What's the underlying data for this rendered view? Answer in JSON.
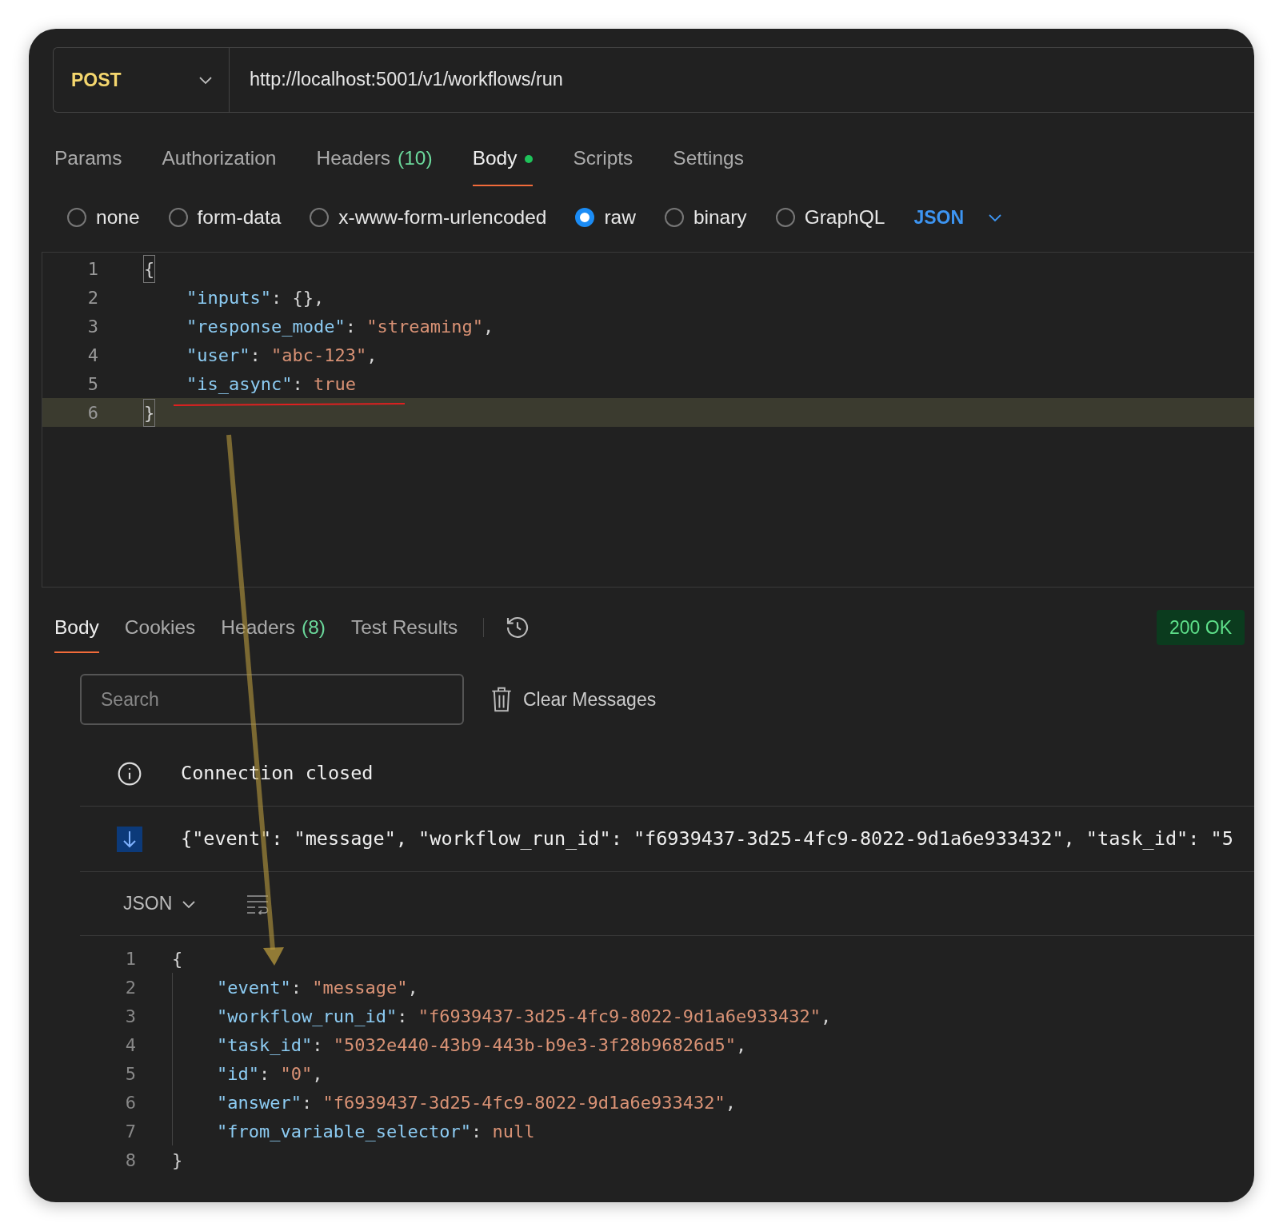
{
  "request": {
    "method": "POST",
    "url": "http://localhost:5001/v1/workflows/run"
  },
  "request_tabs": [
    {
      "label": "Params",
      "selected": false
    },
    {
      "label": "Authorization",
      "selected": false
    },
    {
      "label": "Headers",
      "count": "(10)",
      "selected": false
    },
    {
      "label": "Body",
      "dot": true,
      "selected": true
    },
    {
      "label": "Scripts",
      "selected": false
    },
    {
      "label": "Settings",
      "selected": false
    }
  ],
  "body_types": [
    {
      "label": "none",
      "selected": false
    },
    {
      "label": "form-data",
      "selected": false
    },
    {
      "label": "x-www-form-urlencoded",
      "selected": false
    },
    {
      "label": "raw",
      "selected": true
    },
    {
      "label": "binary",
      "selected": false
    },
    {
      "label": "GraphQL",
      "selected": false
    }
  ],
  "body_language": "JSON",
  "request_body": [
    {
      "number": "1",
      "indented": false,
      "highlighted": false,
      "tokens": [
        {
          "kind": "bracket",
          "text": "{"
        }
      ]
    },
    {
      "number": "2",
      "indented": true,
      "highlighted": false,
      "tokens": [
        {
          "kind": "key",
          "text": "\"inputs\""
        },
        {
          "kind": "punct",
          "text": ": {},"
        }
      ]
    },
    {
      "number": "3",
      "indented": true,
      "highlighted": false,
      "tokens": [
        {
          "kind": "key",
          "text": "\"response_mode\""
        },
        {
          "kind": "punct",
          "text": ": "
        },
        {
          "kind": "string",
          "text": "\"streaming\""
        },
        {
          "kind": "punct",
          "text": ","
        }
      ]
    },
    {
      "number": "4",
      "indented": true,
      "highlighted": false,
      "tokens": [
        {
          "kind": "key",
          "text": "\"user\""
        },
        {
          "kind": "punct",
          "text": ": "
        },
        {
          "kind": "string",
          "text": "\"abc-123\""
        },
        {
          "kind": "punct",
          "text": ","
        }
      ]
    },
    {
      "number": "5",
      "indented": true,
      "highlighted": false,
      "tokens": [
        {
          "kind": "key",
          "text": "\"is_async\""
        },
        {
          "kind": "punct",
          "text": ": "
        },
        {
          "kind": "string",
          "text": "true"
        }
      ]
    },
    {
      "number": "6",
      "indented": false,
      "highlighted": true,
      "tokens": [
        {
          "kind": "bracket",
          "text": "}"
        }
      ]
    }
  ],
  "response_tabs": [
    {
      "label": "Body",
      "selected": true
    },
    {
      "label": "Cookies",
      "selected": false
    },
    {
      "label": "Headers",
      "count": "(8)",
      "selected": false
    },
    {
      "label": "Test Results",
      "selected": false
    }
  ],
  "status": "200 OK",
  "search": {
    "placeholder": "Search"
  },
  "clear_button": "Clear Messages",
  "messages": [
    {
      "kind": "info",
      "text": "Connection closed"
    },
    {
      "kind": "incoming",
      "text": "{\"event\": \"message\", \"workflow_run_id\": \"f6939437-3d25-4fc9-8022-9d1a6e933432\", \"task_id\": \"5"
    }
  ],
  "message_format": "JSON",
  "response_body": [
    {
      "number": "1",
      "indented": false,
      "tokens": [
        {
          "kind": "punct",
          "text": "{"
        }
      ]
    },
    {
      "number": "2",
      "indented": true,
      "tokens": [
        {
          "kind": "key",
          "text": "\"event\""
        },
        {
          "kind": "punct",
          "text": ": "
        },
        {
          "kind": "string",
          "text": "\"message\""
        },
        {
          "kind": "punct",
          "text": ","
        }
      ]
    },
    {
      "number": "3",
      "indented": true,
      "tokens": [
        {
          "kind": "key",
          "text": "\"workflow_run_id\""
        },
        {
          "kind": "punct",
          "text": ": "
        },
        {
          "kind": "string",
          "text": "\"f6939437-3d25-4fc9-8022-9d1a6e933432\""
        },
        {
          "kind": "punct",
          "text": ","
        }
      ]
    },
    {
      "number": "4",
      "indented": true,
      "tokens": [
        {
          "kind": "key",
          "text": "\"task_id\""
        },
        {
          "kind": "punct",
          "text": ": "
        },
        {
          "kind": "string",
          "text": "\"5032e440-43b9-443b-b9e3-3f28b96826d5\""
        },
        {
          "kind": "punct",
          "text": ","
        }
      ]
    },
    {
      "number": "5",
      "indented": true,
      "tokens": [
        {
          "kind": "key",
          "text": "\"id\""
        },
        {
          "kind": "punct",
          "text": ": "
        },
        {
          "kind": "string",
          "text": "\"0\""
        },
        {
          "kind": "punct",
          "text": ","
        }
      ]
    },
    {
      "number": "6",
      "indented": true,
      "tokens": [
        {
          "kind": "key",
          "text": "\"answer\""
        },
        {
          "kind": "punct",
          "text": ": "
        },
        {
          "kind": "string",
          "text": "\"f6939437-3d25-4fc9-8022-9d1a6e933432\""
        },
        {
          "kind": "punct",
          "text": ","
        }
      ]
    },
    {
      "number": "7",
      "indented": true,
      "tokens": [
        {
          "kind": "key",
          "text": "\"from_variable_selector\""
        },
        {
          "kind": "punct",
          "text": ": "
        },
        {
          "kind": "string",
          "text": "null"
        }
      ]
    },
    {
      "number": "8",
      "indented": false,
      "tokens": [
        {
          "kind": "punct",
          "text": "}"
        }
      ]
    }
  ]
}
